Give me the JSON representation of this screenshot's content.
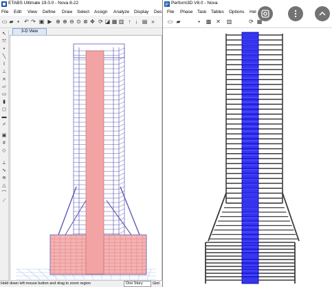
{
  "etabs": {
    "title": "ETABS Ultimate 19.0.0 - Nova 8-22",
    "menu": [
      "File",
      "Edit",
      "View",
      "Define",
      "Draw",
      "Select",
      "Assign",
      "Analyze",
      "Display",
      "Des"
    ],
    "view_tab": "3-D View",
    "status_message": "Hold down left mouse button and drag to zoom region",
    "story_option": "One Story",
    "coord_system": "Glol",
    "colors": {
      "frame": "#5a5ab4",
      "core_fill": "#f2a4a4",
      "podium_fill": "#f6b3b3",
      "ground_grid": "#a9c8ee"
    }
  },
  "perform": {
    "title": "Perform3D V8.0 - Nova",
    "menu": [
      "File",
      "Phase",
      "Task",
      "Tables",
      "Options",
      "Hel"
    ],
    "colors": {
      "frame": "#3a3a3a",
      "core": "#1010ee"
    }
  },
  "overlay": {
    "icons": [
      "lens-icon",
      "more-vertical-icon",
      "collapse-icon"
    ]
  }
}
